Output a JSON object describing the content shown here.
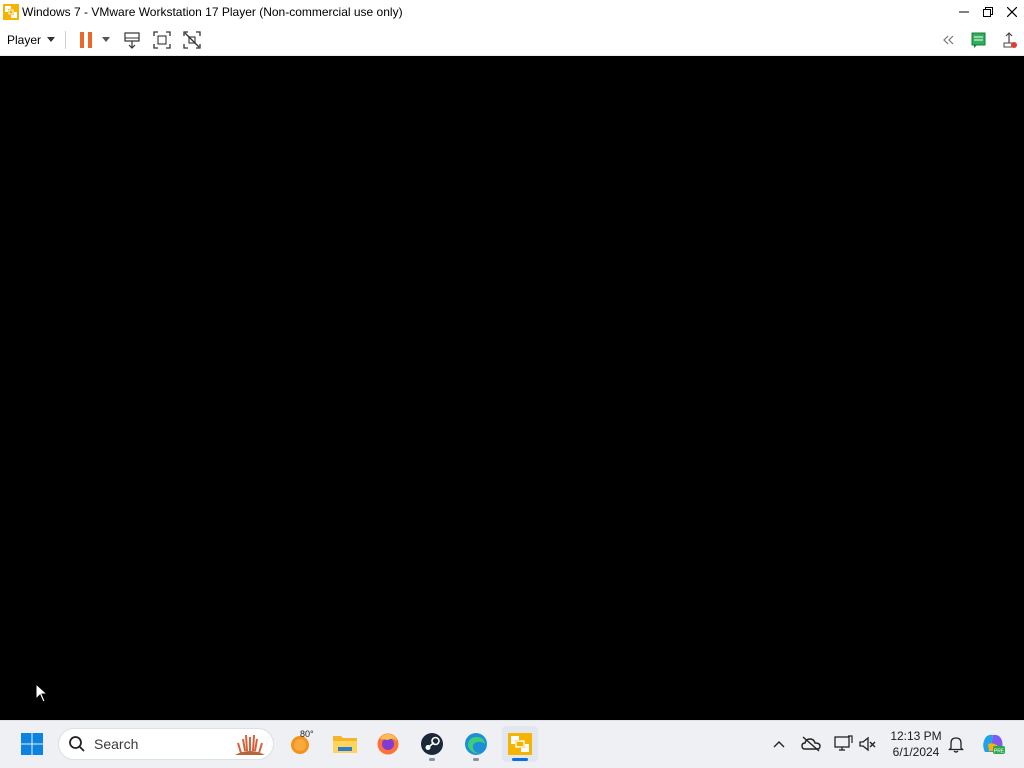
{
  "window": {
    "title": "Windows 7 - VMware Workstation 17 Player (Non-commercial use only)",
    "icon": "vmware-icon",
    "controls": [
      "minimize-icon",
      "restore-icon",
      "close-icon"
    ]
  },
  "toolbar": {
    "player_label": "Player",
    "left_icons": [
      "pause-icon",
      "dropdown-arrow-icon",
      "send-ctrl-alt-del-icon",
      "full-screen-icon",
      "unity-icon"
    ],
    "right_icons": [
      "collapse-toolbar-icon",
      "message-log-icon",
      "removable-devices-icon"
    ],
    "accent_color": "#e8692a"
  },
  "taskbar": {
    "search_placeholder": "Search",
    "weather_temp": "80°",
    "apps": [
      "start-icon",
      "weather-icon",
      "file-explorer-icon",
      "firefox-icon",
      "steam-icon",
      "edge-icon",
      "vmware-player-icon"
    ],
    "active_app": "vmware-player-icon",
    "tray_icons": [
      "show-hidden-icons-chevron-icon",
      "onedrive-icon",
      "network-icon",
      "volume-muted-icon",
      "notification-bell-icon",
      "copilot-icon"
    ],
    "time": "12:13 PM",
    "date": "6/1/2024"
  }
}
